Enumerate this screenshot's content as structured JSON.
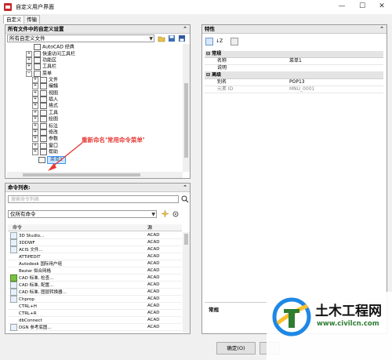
{
  "window": {
    "title": "自定义用户界面",
    "minimize": "—",
    "maximize": "☐",
    "close": "✕"
  },
  "tabs": [
    {
      "label": "自定义",
      "active": true
    },
    {
      "label": "传输",
      "active": false
    }
  ],
  "customizations_panel": {
    "title": "所有文件中的自定义设置",
    "collapse": "⌃",
    "filter_value": "所有自定义文件",
    "tree": [
      {
        "label": "AutoCAD 经典",
        "expand": ""
      },
      {
        "label": "快速访问工具栏",
        "expand": "+"
      },
      {
        "label": "功能区",
        "expand": "+"
      },
      {
        "label": "工具栏",
        "expand": "+"
      },
      {
        "label": "菜单",
        "expand": "−"
      },
      {
        "label": "文件",
        "expand": "+"
      },
      {
        "label": "编辑",
        "expand": "+"
      },
      {
        "label": "视图",
        "expand": "+"
      },
      {
        "label": "插入",
        "expand": "+"
      },
      {
        "label": "格式",
        "expand": "+"
      },
      {
        "label": "工具",
        "expand": "+"
      },
      {
        "label": "绘图",
        "expand": "+"
      },
      {
        "label": "标注",
        "expand": "+"
      },
      {
        "label": "修改",
        "expand": "+"
      },
      {
        "label": "参数",
        "expand": "+"
      },
      {
        "label": "窗口",
        "expand": "+"
      },
      {
        "label": "帮助",
        "expand": "+"
      },
      {
        "label": "菜单1",
        "expand": "",
        "selected": true
      }
    ],
    "annotation": "重新命名‘常用命令菜单’"
  },
  "command_list_panel": {
    "title": "命令列表:",
    "collapse": "⌃",
    "search_placeholder": "搜索命令列表",
    "filter_value": "仅所有命令",
    "columns": {
      "command": "命令",
      "source": "源"
    },
    "rows": [
      {
        "command": "3D Studio...",
        "source": "ACAD"
      },
      {
        "command": "3DDWF",
        "source": "ACAD"
      },
      {
        "command": "ACIS 文件...",
        "source": "ACAD"
      },
      {
        "command": "ATTIPEDIT",
        "source": "ACAD"
      },
      {
        "command": "Autodesk 国际用户组",
        "source": "ACAD"
      },
      {
        "command": "Bezier 拟合网格",
        "source": "ACAD"
      },
      {
        "command": "CAD 标准, 检查...",
        "source": "ACAD"
      },
      {
        "command": "CAD 标准, 配置...",
        "source": "ACAD"
      },
      {
        "command": "CAD 标准, 图层转换器...",
        "source": "ACAD"
      },
      {
        "command": "Chprop",
        "source": "ACAD"
      },
      {
        "command": "CTRL+H",
        "source": "ACAD"
      },
      {
        "command": "CTRL+R",
        "source": "ACAD"
      },
      {
        "command": "dbConnect",
        "source": "ACAD"
      },
      {
        "command": "DGN 参考底图...",
        "source": "ACAD"
      }
    ]
  },
  "properties_panel": {
    "title": "特性",
    "collapse": "⌃",
    "categories": [
      {
        "name": "常规",
        "rows": [
          {
            "key": "名称",
            "value": "菜单1"
          },
          {
            "key": "说明",
            "value": ""
          }
        ]
      },
      {
        "name": "高级",
        "rows": [
          {
            "key": "别名",
            "value": "POP13"
          },
          {
            "key": "元素 ID",
            "value": "MNU_0001"
          }
        ]
      }
    ],
    "description_title": "常规"
  },
  "buttons": {
    "ok": "确定(O)"
  },
  "watermark": {
    "brand": "土木工程网",
    "url": "www.civilcn.com"
  },
  "colors": {
    "annotation": "#e53935",
    "selected": "#3399ff"
  }
}
